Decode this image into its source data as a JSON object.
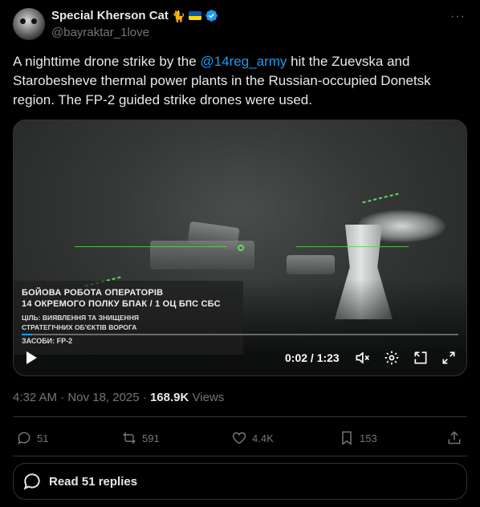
{
  "author": {
    "display_name": "Special Kherson Cat",
    "emoji": "🐈",
    "handle": "@bayraktar_1love"
  },
  "more_label": "···",
  "tweet": {
    "text_before": "A nighttime drone strike by the ",
    "mention": "@14reg_army",
    "text_after": " hit the Zuevska and Starobesheve thermal power plants in the Russian-occupied Donetsk region. The FP-2 guided strike drones were used."
  },
  "video": {
    "caption_line1": "БОЙОВА РОБОТА ОПЕРАТОРІВ",
    "caption_line2": "14 ОКРЕМОГО ПОЛКУ БПАК / 1 ОЦ БПС СБС",
    "caption_line3": "ЦІЛЬ: ВИЯВЛЕННЯ ТА ЗНИЩЕННЯ",
    "caption_line4": "СТРАТЕГІЧНИХ ОБ'ЄКТІВ ВОРОГА",
    "caption_line5": "ЗАСОБИ: FP-2",
    "time": "0:02 / 1:23",
    "progress_fraction": 0.024
  },
  "meta": {
    "time": "4:32 AM",
    "sep1": " · ",
    "date": "Nov 18, 2025",
    "sep2": " · ",
    "views_count": "168.9K",
    "views_label": " Views"
  },
  "actions": {
    "replies": "51",
    "reposts": "591",
    "likes": "4.4K",
    "bookmarks": "153"
  },
  "read_replies": "Read 51 replies",
  "colors": {
    "accent": "#1d9bf0",
    "background": "#000000",
    "muted": "#71767b"
  }
}
